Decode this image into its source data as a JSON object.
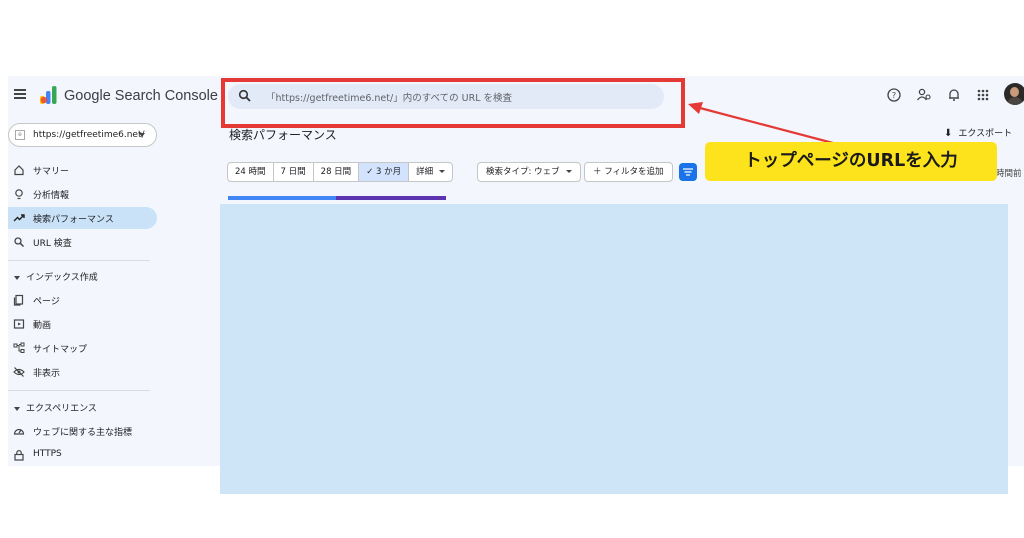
{
  "app": {
    "title": "Google Search Console"
  },
  "search": {
    "placeholder": "「https://getfreetime6.net/」内のすべての URL を検査"
  },
  "property": {
    "url": "https://getfreetime6.net/"
  },
  "sidebar": {
    "items": [
      {
        "label": "サマリー",
        "icon": "home-icon"
      },
      {
        "label": "分析情報",
        "icon": "lightbulb-icon"
      },
      {
        "label": "検索パフォーマンス",
        "icon": "trending-up-icon",
        "active": true
      },
      {
        "label": "URL 検査",
        "icon": "search-icon"
      }
    ],
    "sections": [
      {
        "title": "インデックス作成",
        "items": [
          {
            "label": "ページ",
            "icon": "pages-icon"
          },
          {
            "label": "動画",
            "icon": "video-icon"
          },
          {
            "label": "サイトマップ",
            "icon": "sitemap-icon"
          },
          {
            "label": "非表示",
            "icon": "visibility-off-icon"
          }
        ]
      },
      {
        "title": "エクスペリエンス",
        "items": [
          {
            "label": "ウェブに関する主な指標",
            "icon": "speedometer-icon"
          },
          {
            "label": "HTTPS",
            "icon": "lock-icon"
          }
        ]
      }
    ]
  },
  "main": {
    "page_title": "検索パフォーマンス",
    "export_label": "エクスポート",
    "date_chips": [
      "24 時間",
      "7 日間",
      "28 日間",
      "✓ 3 か月",
      "詳細"
    ],
    "selected_date_chip": "3 か月",
    "search_type_label": "検索タイプ: ウェブ",
    "add_filter_label": "＋ フィルタを追加",
    "last_updated": "時間前"
  },
  "annotation": {
    "callout_text": "トップページのURLを入力",
    "callout_color": "#fde31c",
    "highlight_color": "#e53935"
  },
  "colors": {
    "accent_blue": "#1a73e8",
    "active_nav_bg": "#c9e2f8",
    "overlay": "#cde5f6"
  }
}
